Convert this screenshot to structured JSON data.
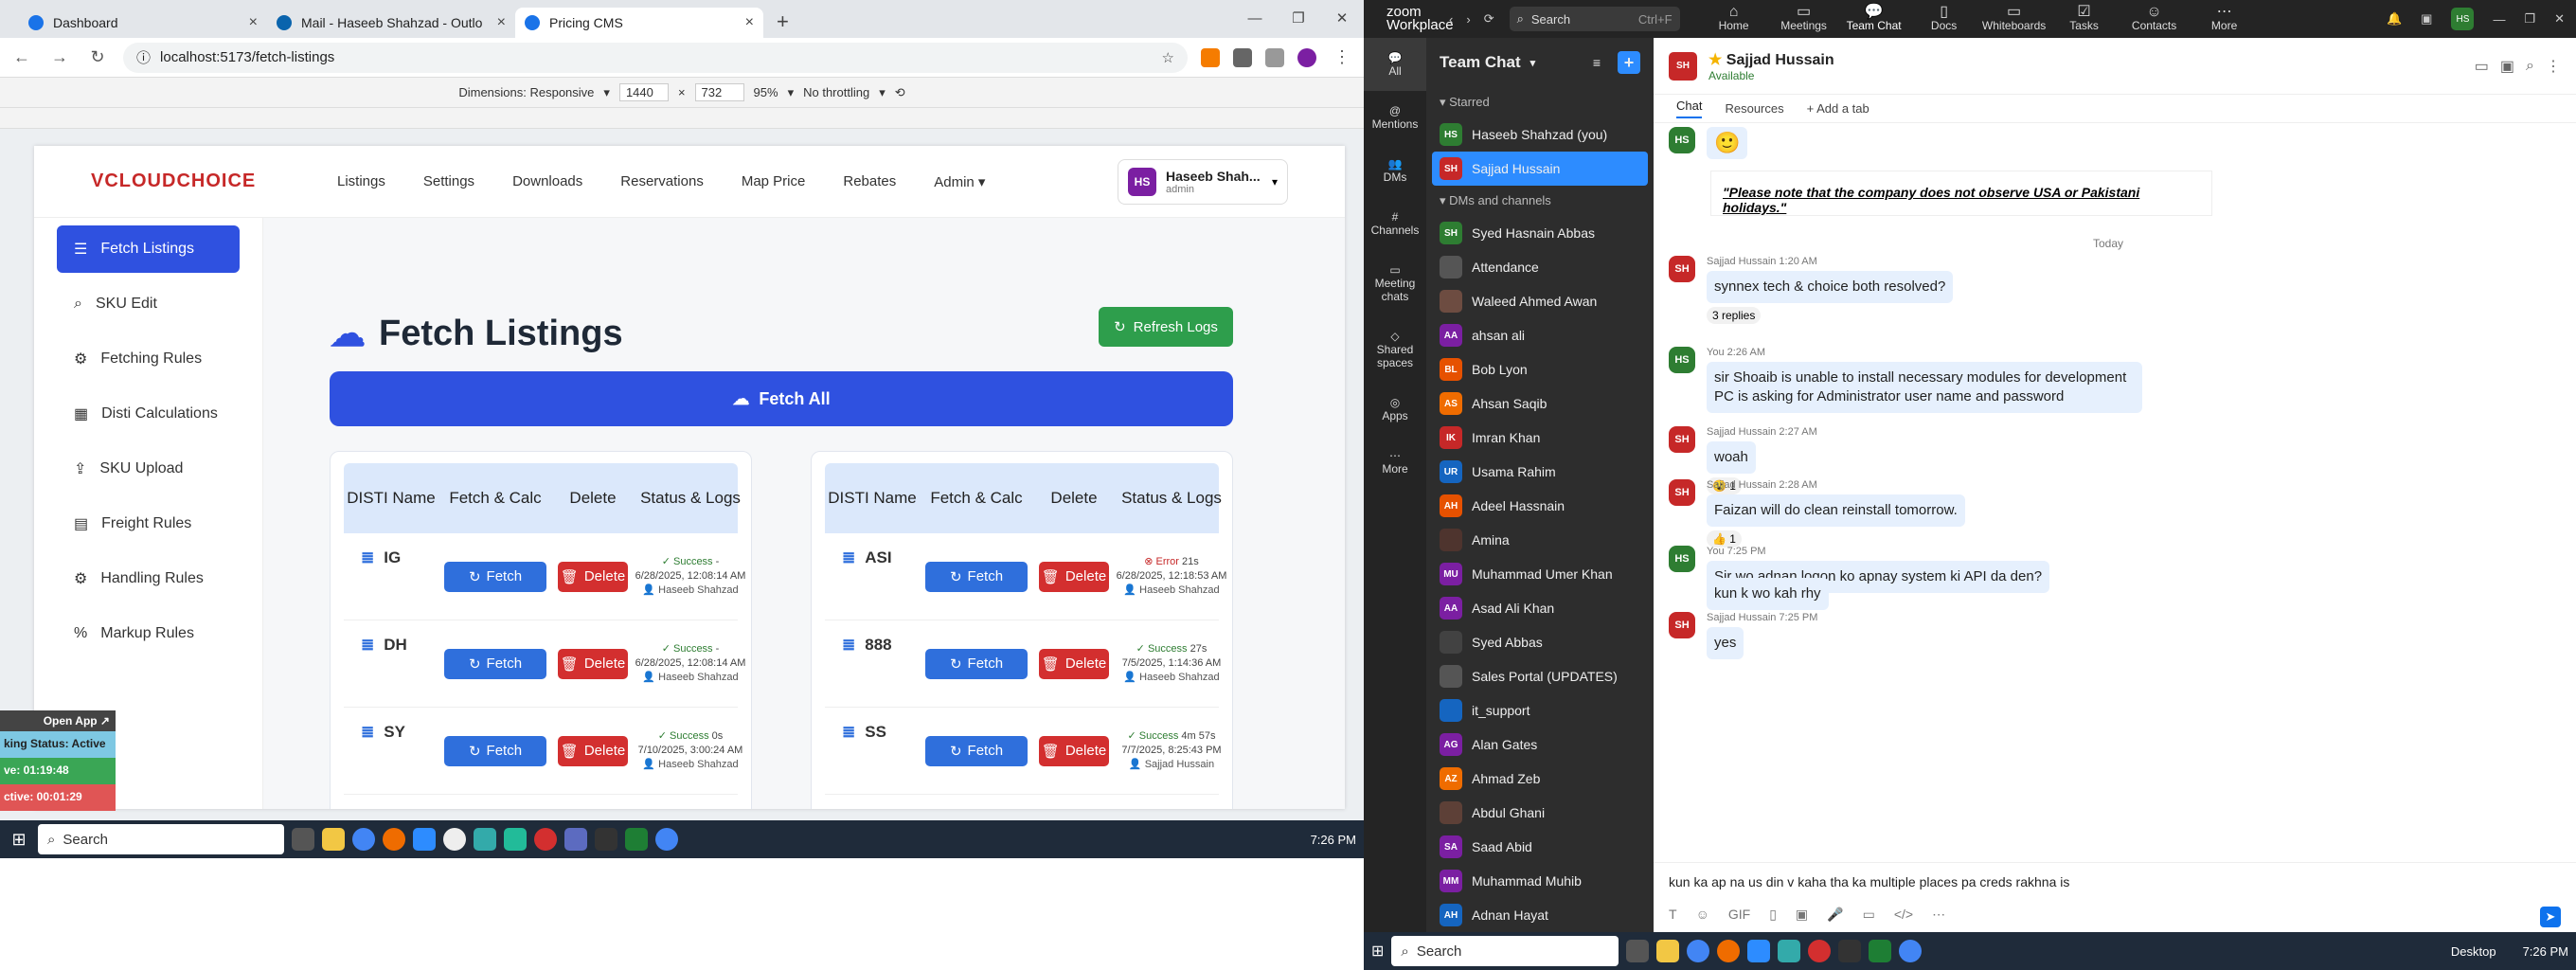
{
  "browser": {
    "tabs": [
      {
        "title": "Dashboard",
        "color": "#1a73e8"
      },
      {
        "title": "Mail - Haseeb Shahzad - Outlo",
        "color": "#0a64ad"
      },
      {
        "title": "Pricing CMS",
        "color": "#1a73e8"
      }
    ],
    "url": "localhost:5173/fetch-listings",
    "device": {
      "dimensions_label": "Dimensions: Responsive",
      "width": "1440",
      "height": "732",
      "zoom": "95%",
      "throttle": "No throttling"
    }
  },
  "cms": {
    "logo": "CLOUDCHOICE",
    "menu": [
      "Listings",
      "Settings",
      "Downloads",
      "Reservations",
      "Map Price",
      "Rebates",
      "Admin"
    ],
    "user": {
      "initials": "HS",
      "name": "Haseeb Shah...",
      "role": "admin"
    },
    "sidebar": [
      {
        "label": "Fetch Listings",
        "icon": "list-icon"
      },
      {
        "label": "SKU Edit",
        "icon": "search-icon"
      },
      {
        "label": "Fetching Rules",
        "icon": "gear-icon"
      },
      {
        "label": "Disti Calculations",
        "icon": "table-icon"
      },
      {
        "label": "SKU Upload",
        "icon": "upload-icon"
      },
      {
        "label": "Freight Rules",
        "icon": "book-icon"
      },
      {
        "label": "Handling Rules",
        "icon": "gear-icon"
      },
      {
        "label": "Markup Rules",
        "icon": "percent-icon"
      }
    ],
    "title": "Fetch Listings",
    "refresh_label": "Refresh Logs",
    "fetch_all_label": "Fetch All",
    "headers": [
      "DISTI Name",
      "Fetch & Calc",
      "Delete",
      "Status & Logs"
    ],
    "fetch_label": "Fetch",
    "delete_label": "Delete",
    "left_rows": [
      {
        "name": "IG",
        "status": "Success",
        "dur": "-",
        "time": "6/28/2025, 12:08:14 AM",
        "who": "Haseeb Shahzad"
      },
      {
        "name": "DH",
        "status": "Success",
        "dur": "-",
        "time": "6/28/2025, 12:08:14 AM",
        "who": "Haseeb Shahzad"
      },
      {
        "name": "SY",
        "status": "Success",
        "dur": "0s",
        "time": "7/10/2025, 3:00:24 AM",
        "who": "Haseeb Shahzad"
      }
    ],
    "right_rows": [
      {
        "name": "ASI",
        "status": "Error",
        "dur": "21s",
        "time": "6/28/2025, 12:18:53 AM",
        "who": "Haseeb Shahzad"
      },
      {
        "name": "888",
        "status": "Success",
        "dur": "27s",
        "time": "7/5/2025, 1:14:36 AM",
        "who": "Haseeb Shahzad"
      },
      {
        "name": "SS",
        "status": "Success",
        "dur": "4m 57s",
        "time": "7/7/2025, 8:25:43 PM",
        "who": "Sajjad Hussain"
      }
    ]
  },
  "overlay": {
    "open_app": "Open App ↗",
    "status": "king Status: Active",
    "live": "ve: 01:19:48",
    "inactive": "ctive: 00:01:29"
  },
  "taskbar": {
    "search": "Search",
    "time": "7:26 PM"
  },
  "zoom": {
    "brand": "zoom",
    "product": "Workplace",
    "search_label": "Search",
    "search_shortcut": "Ctrl+F",
    "nav": [
      "Home",
      "Meetings",
      "Team Chat",
      "Docs",
      "Whiteboards",
      "Tasks",
      "Contacts",
      "More"
    ],
    "rail": [
      "All",
      "Mentions",
      "DMs",
      "Channels",
      "Meeting chats",
      "Shared spaces",
      "Apps",
      "More"
    ],
    "list_title": "Team Chat",
    "starred_label": "Starred",
    "dms_label": "DMs and channels",
    "starred": [
      {
        "name": "Haseeb Shahzad (you)",
        "initials": "HS",
        "color": "#2e7d32"
      },
      {
        "name": "Sajjad Hussain",
        "initials": "SH",
        "color": "#c62828"
      }
    ],
    "contacts": [
      {
        "name": "Syed Hasnain Abbas",
        "initials": "SH",
        "color": "#2e7d32"
      },
      {
        "name": "Attendance",
        "initials": "",
        "color": "#555555"
      },
      {
        "name": "Waleed Ahmed Awan",
        "initials": "",
        "color": "#6d4c41"
      },
      {
        "name": "ahsan ali",
        "initials": "AA",
        "color": "#7b1fa2"
      },
      {
        "name": "Bob Lyon",
        "initials": "BL",
        "color": "#e65100"
      },
      {
        "name": "Ahsan Saqib",
        "initials": "AS",
        "color": "#ef6c00"
      },
      {
        "name": "Imran Khan",
        "initials": "IK",
        "color": "#c62828"
      },
      {
        "name": "Usama Rahim",
        "initials": "UR",
        "color": "#1565c0"
      },
      {
        "name": "Adeel Hassnain",
        "initials": "AH",
        "color": "#e65100"
      },
      {
        "name": "Amina",
        "initials": "",
        "color": "#4e342e"
      },
      {
        "name": "Muhammad Umer Khan",
        "initials": "MU",
        "color": "#7b1fa2"
      },
      {
        "name": "Asad Ali Khan",
        "initials": "AA",
        "color": "#7b1fa2"
      },
      {
        "name": "Syed Abbas",
        "initials": "",
        "color": "#424242"
      },
      {
        "name": "Sales Portal (UPDATES)",
        "initials": "",
        "color": "#555555"
      },
      {
        "name": "it_support",
        "initials": "",
        "color": "#1565c0"
      },
      {
        "name": "Alan Gates",
        "initials": "AG",
        "color": "#7b1fa2"
      },
      {
        "name": "Ahmad Zeb",
        "initials": "AZ",
        "color": "#ef6c00"
      },
      {
        "name": "Abdul Ghani",
        "initials": "",
        "color": "#5d4037"
      },
      {
        "name": "Saad Abid",
        "initials": "SA",
        "color": "#7b1fa2"
      },
      {
        "name": "Muhammad Muhib",
        "initials": "MM",
        "color": "#7b1fa2"
      },
      {
        "name": "Adnan Hayat",
        "initials": "AH",
        "color": "#1565c0"
      }
    ],
    "chat": {
      "name": "Sajjad Hussain",
      "status": "Available",
      "tabs": [
        "Chat",
        "Resources",
        "+ Add a tab"
      ],
      "notice": "\"Please note that the company does not observe USA or Pakistani holidays.\"",
      "today": "Today",
      "messages": [
        {
          "who": "SH",
          "meta": "Sajjad Hussain 1:20 AM",
          "text": "synnex tech & choice both resolved?",
          "extra": "3 replies"
        },
        {
          "who": "HS",
          "meta": "You 2:26 AM",
          "text": "sir Shoaib is unable to install necessary modules for development PC is asking for Administrator user name and password",
          "extra": ""
        },
        {
          "who": "SH",
          "meta": "Sajjad Hussain 2:27 AM",
          "text": "woah",
          "extra": "😮 1"
        },
        {
          "who": "SH",
          "meta": "Sajjad Hussain 2:28 AM",
          "text": "Faizan will do clean reinstall tomorrow.",
          "extra": "👍 1"
        },
        {
          "who": "HS",
          "meta": "You 7:25 PM",
          "text": "Sir wo adnan logon ko apnay system ki API da den?",
          "extra": ""
        },
        {
          "who": "HS",
          "meta": "",
          "text": "kun k wo kah rhy",
          "extra": ""
        },
        {
          "who": "SH",
          "meta": "Sajjad Hussain 7:25 PM",
          "text": "yes",
          "extra": ""
        }
      ],
      "compose": "kun ka ap na us din v kaha tha ka multiple places pa creds rakhna is"
    },
    "taskbar_search": "Search",
    "desktop": "Desktop",
    "time": "7:26 PM"
  }
}
